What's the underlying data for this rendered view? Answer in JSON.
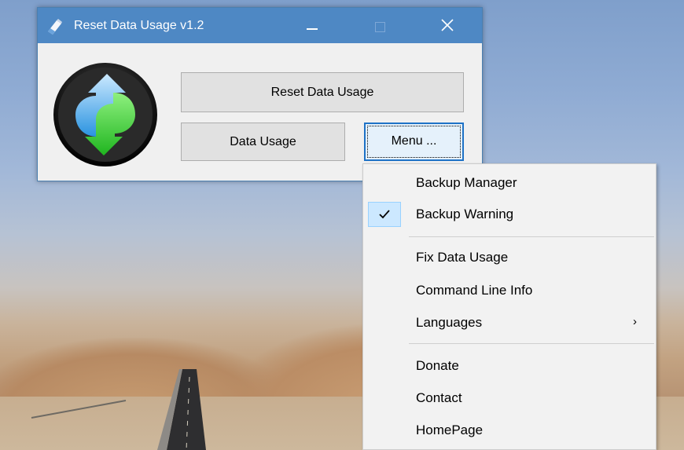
{
  "window": {
    "title": "Reset Data Usage v1.2",
    "controls": {
      "minimize": "minimize",
      "maximize": "maximize",
      "close": "close"
    }
  },
  "buttons": {
    "reset_data_usage": "Reset Data Usage",
    "data_usage": "Data Usage",
    "menu": "Menu ..."
  },
  "menu": {
    "items": [
      {
        "label": "Backup Manager",
        "checked": false
      },
      {
        "label": "Backup Warning",
        "checked": true
      },
      {
        "label": "Fix Data Usage",
        "checked": false
      },
      {
        "label": "Command Line Info",
        "checked": false
      },
      {
        "label": "Languages",
        "checked": false,
        "submenu": true
      },
      {
        "label": "Donate",
        "checked": false
      },
      {
        "label": "Contact",
        "checked": false
      },
      {
        "label": "HomePage",
        "checked": false
      }
    ],
    "submenu_arrow": "›"
  },
  "colors": {
    "titlebar": "#4e88c4",
    "menu_check_highlight": "#cce8ff",
    "focus_border": "#1e72c6"
  },
  "icons": {
    "app": "eraser-icon",
    "logo": "reset-arrows-logo",
    "check": "checkmark-icon",
    "submenu": "chevron-right-icon"
  }
}
